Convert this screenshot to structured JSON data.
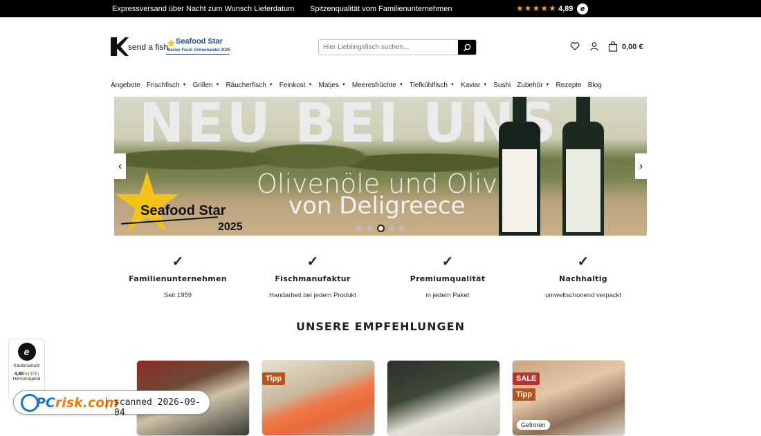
{
  "topbar": {
    "left_text": "Expressversand über Nacht zum Wunsch Lieferdatum",
    "mid_text": "Spitzenqualität vom Familienunternehmen",
    "stars": "★★★★★",
    "rating": "4,89",
    "badge": "e"
  },
  "header": {
    "logo_name": "send a fish",
    "logo_badge": "Seafood Star",
    "logo_badge_sub": "Bester Fisch Onlinehandel 2025",
    "search": {
      "placeholder": "Hier Lieblingsfisch suchen..."
    },
    "cart_total": "0,00 €"
  },
  "nav": [
    {
      "label": "Angebote",
      "dropdown": false
    },
    {
      "label": "Frischfisch",
      "dropdown": true
    },
    {
      "label": "Grillen",
      "dropdown": true
    },
    {
      "label": "Räucherfisch",
      "dropdown": true
    },
    {
      "label": "Feinkost",
      "dropdown": true
    },
    {
      "label": "Matjes",
      "dropdown": true
    },
    {
      "label": "Meeresfrüchte",
      "dropdown": true
    },
    {
      "label": "Tiefkühlfisch",
      "dropdown": true
    },
    {
      "label": "Kaviar",
      "dropdown": true
    },
    {
      "label": "Sushi",
      "dropdown": false
    },
    {
      "label": "Zubehör",
      "dropdown": true
    },
    {
      "label": "Rezepte",
      "dropdown": false
    },
    {
      "label": "Blog",
      "dropdown": false
    }
  ],
  "hero": {
    "headline": "NEU BEI UNS",
    "line1": "Olivenöle und Oliven",
    "line2": "von Deligreece",
    "badge_top": "Seafood Star",
    "badge_year": "2025",
    "prev": "‹",
    "next": "›",
    "slide_count": 5,
    "active_slide": 3
  },
  "usps": [
    {
      "title": "Familienunternehmen",
      "sub": "Seit 1959"
    },
    {
      "title": "Fischmanufaktur",
      "sub": "Handarbeit bei jedem Produkt"
    },
    {
      "title": "Premiumqualität",
      "sub": "in jedem Paket"
    },
    {
      "title": "Nachhaltig",
      "sub": "umweltschonend verpackt"
    }
  ],
  "section_title": "UNSERE EMPFEHLUNGEN",
  "products": [
    {
      "tags": [],
      "badge": ""
    },
    {
      "tags": [
        "Tipp"
      ],
      "badge": ""
    },
    {
      "tags": [],
      "badge": ""
    },
    {
      "tags": [
        "SALE",
        "Tipp"
      ],
      "badge": "Gefroren"
    }
  ],
  "trust": {
    "seal": "e",
    "label": "Käuferschutz",
    "rating": "4,89",
    "star": "★",
    "count": "(36k)",
    "verdict": "Hervorragend"
  },
  "watermark": {
    "brand_pc": "PC",
    "brand_risk": "risk.com",
    "scanned": "scanned 2026-09-04"
  },
  "colors": {
    "tipp": "#b5541b",
    "sale": "#c0312b",
    "accent_star": "#f0a030",
    "logo_blue": "#1b4f8a"
  }
}
